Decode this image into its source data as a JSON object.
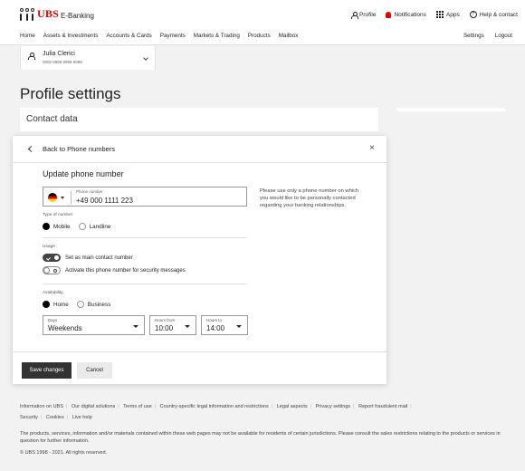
{
  "header": {
    "brand": "UBS",
    "product": "E-Banking",
    "top_links": {
      "profile": "Profile",
      "notifications": "Notifications",
      "apps": "Apps",
      "help": "Help & contact"
    }
  },
  "nav": {
    "items": [
      "Home",
      "Assets & Investments",
      "Accounts & Cards",
      "Payments",
      "Markets & Trading",
      "Products",
      "Mailbox"
    ],
    "settings": "Settings",
    "logout": "Logout"
  },
  "account": {
    "name": "Julia Clerici",
    "number": "0000 8999 9999 9999"
  },
  "page": {
    "title": "Profile settings",
    "section": "Contact data"
  },
  "modal": {
    "back": "Back to Phone numbers",
    "close": "×",
    "heading": "Update phone number",
    "phone_label": "Phone number",
    "phone_value": "+49 000 1111 223",
    "info": "Please use only a phone number on which you would like to be personally contacted regarding your banking relationships.",
    "type_label": "Type of number",
    "type_mobile": "Mobile",
    "type_landline": "Landline",
    "usage_label": "Usage",
    "usage_main": "Set as main contact number",
    "usage_security": "Activate this phone number for security messages",
    "availability_label": "Availability",
    "avail_home": "Home",
    "avail_business": "Business",
    "days_label": "Days",
    "days_value": "Weekends",
    "from_label": "Hours from",
    "from_value": "10:00",
    "to_label": "Hours to",
    "to_value": "14:00",
    "save": "Save changes",
    "cancel": "Cancel"
  },
  "footer": {
    "links": [
      "Information on UBS",
      "Our digital solutions",
      "Terms of use",
      "Country-specific legal information and restrictions",
      "Legal aspects",
      "Privacy settings",
      "Report fraudulent mail",
      "Security",
      "Cookies",
      "Live help"
    ],
    "legal": "The products, services, information and/or materials contained within these web pages may not be available for residents of certain jurisdictions. Please consult the sales restrictions relating to the products or services in question for further information.",
    "copyright": "© UBS 1998 - 2021. All rights reserved."
  }
}
